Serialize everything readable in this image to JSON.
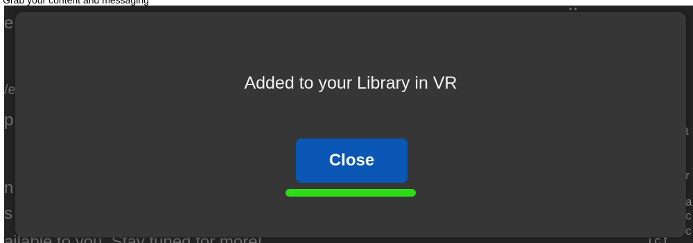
{
  "page_header": {
    "text": "Grab your content and messaging"
  },
  "background": {
    "left_fragments": [
      "e",
      "/e",
      "p",
      "n",
      "s",
      "ailable to you. Stay tuned for more!"
    ],
    "right_fragments": [
      "a",
      "r",
      "a",
      "c",
      "c",
      "i c f"
    ],
    "top_glyph": "••"
  },
  "modal": {
    "message": "Added to your Library in VR",
    "close_label": "Close"
  },
  "colors": {
    "modal_bg": "#363636",
    "button_bg": "#0a57b5",
    "highlight": "#2ddb17"
  }
}
